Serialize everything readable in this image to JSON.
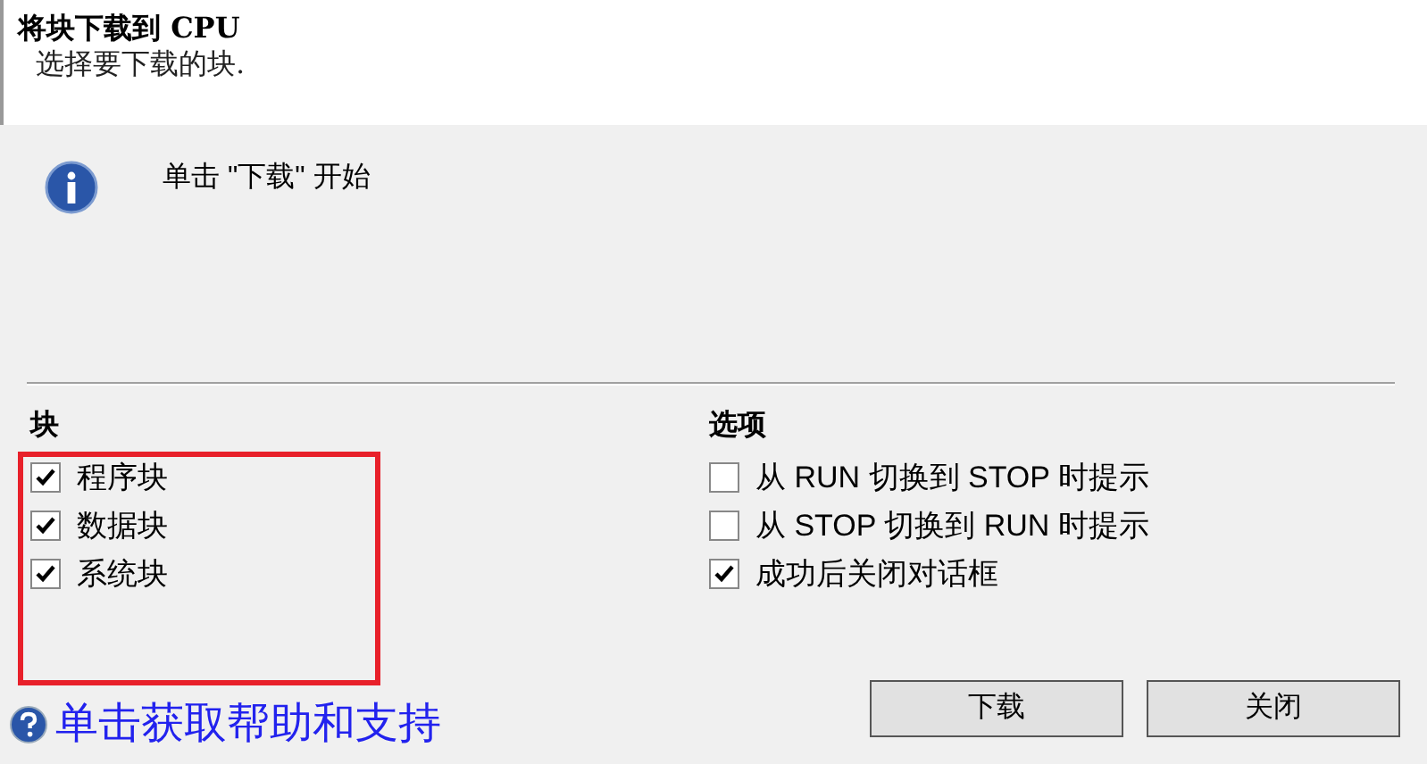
{
  "header": {
    "title": "将块下载到 CPU",
    "subtitle": "选择要下载的块."
  },
  "message": "单击 \"下载\" 开始",
  "blocks": {
    "heading": "块",
    "items": [
      {
        "label": "程序块",
        "checked": true
      },
      {
        "label": "数据块",
        "checked": true
      },
      {
        "label": "系统块",
        "checked": true
      }
    ]
  },
  "options": {
    "heading": "选项",
    "items": [
      {
        "label": "从 RUN 切换到 STOP 时提示",
        "checked": false
      },
      {
        "label": "从 STOP 切换到 RUN 时提示",
        "checked": false
      },
      {
        "label": "成功后关闭对话框",
        "checked": true
      }
    ]
  },
  "help_link": "单击获取帮助和支持",
  "buttons": [
    "下载",
    "关闭"
  ]
}
